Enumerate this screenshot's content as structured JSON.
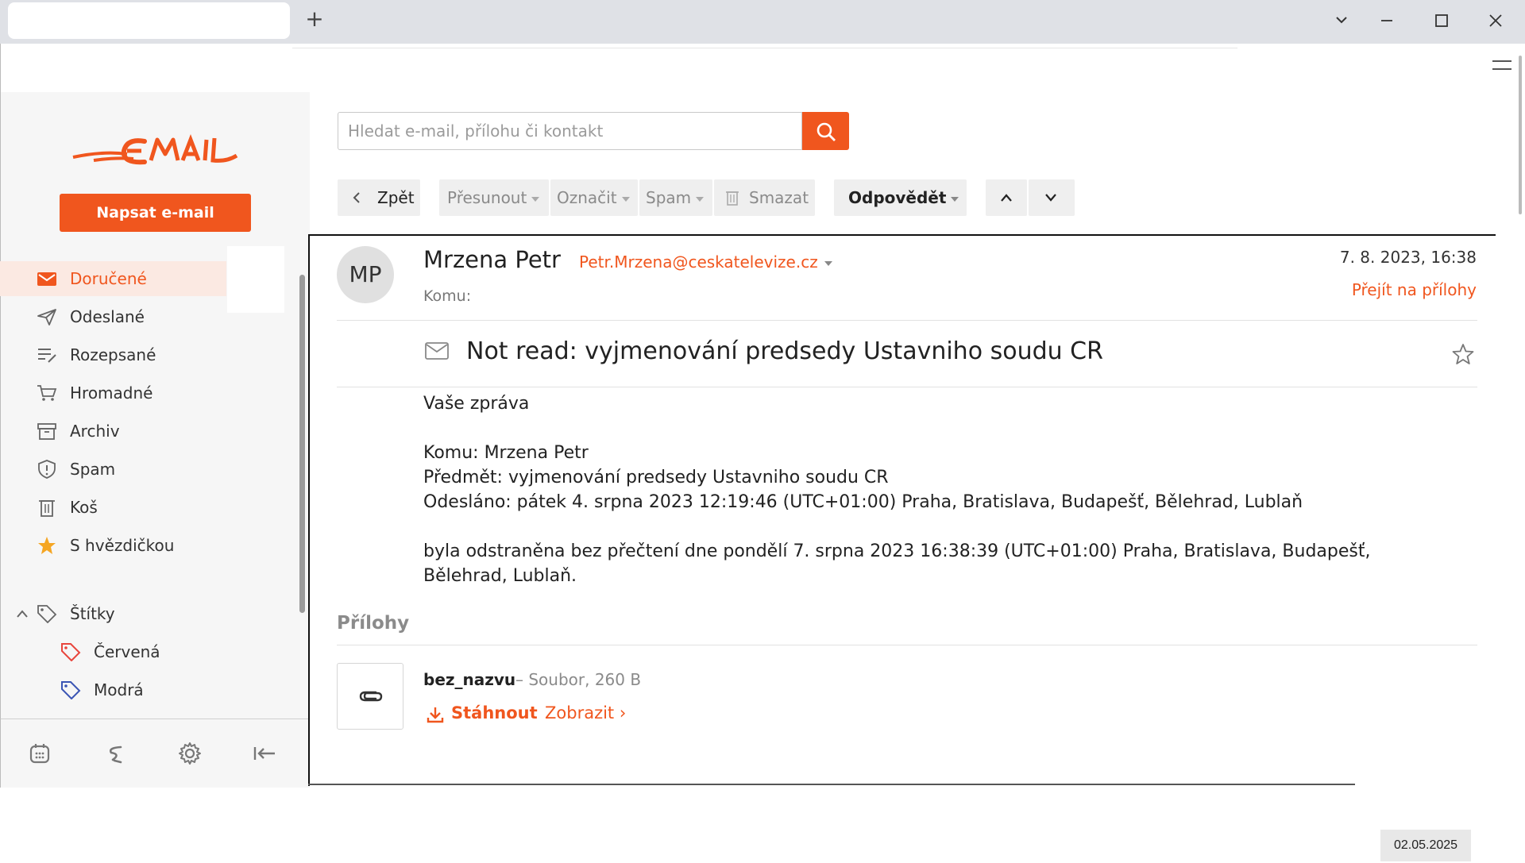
{
  "browser": {
    "new_tab": "+",
    "window_controls": [
      "chevron-down-icon",
      "minimize-icon",
      "maximize-icon",
      "close-icon"
    ]
  },
  "sidebar": {
    "compose_label": "Napsat e-mail",
    "logo_alt": "EMAIL",
    "items": [
      {
        "label": "Doručené",
        "icon": "inbox-icon",
        "active": true
      },
      {
        "label": "Odeslané",
        "icon": "send-icon"
      },
      {
        "label": "Rozepsané",
        "icon": "drafts-icon"
      },
      {
        "label": "Hromadné",
        "icon": "cart-icon"
      },
      {
        "label": "Archiv",
        "icon": "archive-icon"
      },
      {
        "label": "Spam",
        "icon": "shield-icon"
      },
      {
        "label": "Koš",
        "icon": "trash-icon"
      },
      {
        "label": "S hvězdičkou",
        "icon": "star-icon"
      }
    ],
    "labels_section": "Štítky",
    "labels": [
      {
        "label": "Červená",
        "color": "#e8453c"
      },
      {
        "label": "Modrá",
        "color": "#3a55b4"
      }
    ],
    "bottom_icons": [
      "calendar-icon",
      "s-icon",
      "settings-icon",
      "collapse-icon"
    ]
  },
  "search": {
    "placeholder": "Hledat e-mail, přílohu či kontakt"
  },
  "toolbar": {
    "back": "Zpět",
    "move": "Přesunout",
    "mark": "Označit",
    "spam": "Spam",
    "delete": "Smazat",
    "reply": "Odpovědět"
  },
  "message": {
    "avatar_initials": "MP",
    "sender_name": "Mrzena Petr",
    "sender_email": "Petr.Mrzena@ceskatelevize.cz",
    "to_label": "Komu:",
    "date": "7. 8. 2023, 16:38",
    "goto_attachments": "Přejít na přílohy",
    "subject": "Not read: vyjmenování predsedy Ustavniho soudu CR",
    "body": {
      "l1": "Vaše zpráva",
      "l2": "Komu: Mrzena Petr",
      "l3": "Předmět: vyjmenování predsedy Ustavniho soudu CR",
      "l4": "Odesláno: pátek 4. srpna 2023 12:19:46 (UTC+01:00) Praha, Bratislava, Budapešť, Bělehrad, Lublaň",
      "l5": "byla odstraněna bez přečtení dne pondělí 7. srpna 2023 16:38:39 (UTC+01:00) Praha, Bratislava, Budapešť,",
      "l6": "Bělehrad, Lublaň."
    }
  },
  "attachments": {
    "title": "Přílohy",
    "file_name": "bez_nazvu",
    "file_meta": "– Soubor, 260 B",
    "download": "Stáhnout",
    "show": "Zobrazit ›"
  },
  "taskbar": {
    "date": "02.05.2025"
  },
  "colors": {
    "accent": "#f0561e"
  }
}
